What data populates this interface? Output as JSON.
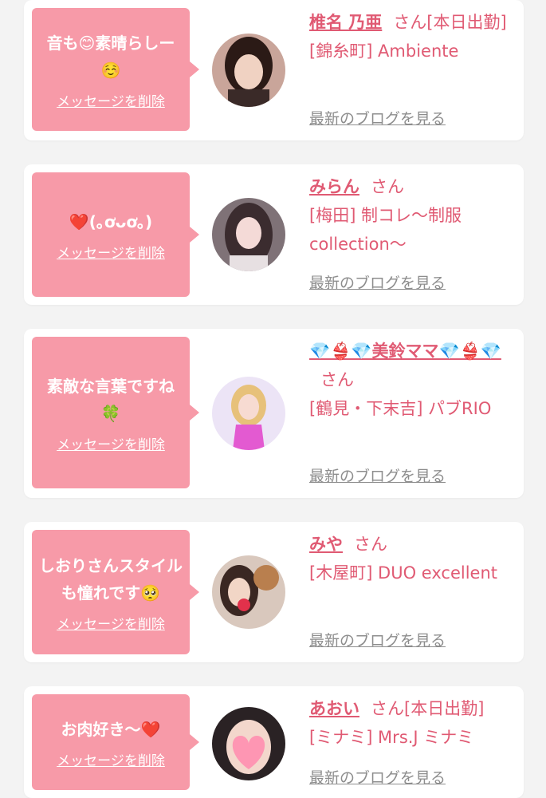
{
  "cards": [
    {
      "message": "音も😊素晴らしー\n☺️",
      "delete_label": "メッセージを削除",
      "name": "椎名 乃亜",
      "suffix": "さん[本日出勤]",
      "shop": "[錦糸町] Ambiente",
      "blog_label": "最新のブログを見る"
    },
    {
      "message": "❤️(｡ơᴗơ｡)",
      "delete_label": "メッセージを削除",
      "name": "みらん",
      "suffix": "さん",
      "shop": "[梅田] 制コレ〜制服collection〜",
      "blog_label": "最新のブログを見る"
    },
    {
      "message": "素敵な言葉ですね\n🍀",
      "delete_label": "メッセージを削除",
      "name": "💎👙💎美鈴ママ💎👙💎",
      "suffix": "さん",
      "shop": "[鶴見・下末吉] パブRIO",
      "blog_label": "最新のブログを見る"
    },
    {
      "message": "しおりさんスタイルも憧れです🥺",
      "delete_label": "メッセージを削除",
      "name": "みや",
      "suffix": "さん",
      "shop": "[木屋町] DUO excellent",
      "blog_label": "最新のブログを見る"
    },
    {
      "message": "お肉好き〜❤️",
      "delete_label": "メッセージを削除",
      "name": "あおい",
      "suffix": "さん[本日出勤]",
      "shop": "[ミナミ] Mrs.J ミナミ",
      "blog_label": "最新のブログを見る"
    }
  ],
  "colors": {
    "bubble": "#f79aa8",
    "accent": "#e05a73",
    "muted": "#8d8d8d",
    "background": "#f3f3f3"
  }
}
